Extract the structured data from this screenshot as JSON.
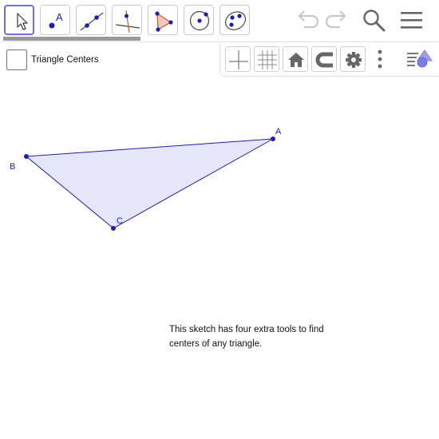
{
  "colors": {
    "accent": "#6d6ee0",
    "point": "#1e1ea8",
    "triangle_fill": "#e6e6fa",
    "triangle_stroke": "#1e1ea8",
    "icon_gray": "#666666"
  },
  "toolbar": {
    "tools": [
      {
        "name": "move-tool",
        "icon": "cursor-arrow-icon",
        "active": true
      },
      {
        "name": "point-tool",
        "icon": "point-icon",
        "label": "A"
      },
      {
        "name": "line-tool",
        "icon": "line-icon"
      },
      {
        "name": "perpendicular-line-tool",
        "icon": "perpendicular-line-icon"
      },
      {
        "name": "polygon-tool",
        "icon": "polygon-icon"
      },
      {
        "name": "circle-center-point-tool",
        "icon": "circle-icon"
      },
      {
        "name": "ellipse-tool",
        "icon": "ellipse-icon"
      }
    ],
    "right_icons": [
      "undo-icon",
      "redo-icon",
      "search-icon",
      "menu-icon"
    ]
  },
  "checkbox": {
    "label": "Triangle Centers",
    "checked": false
  },
  "graphics_style_bar": [
    "axes-icon",
    "grid-icon",
    "home-icon",
    "magnet-icon",
    "settings-gear-icon",
    "more-vertical-icon",
    "toggle-style-bar-icon"
  ],
  "points": {
    "A": {
      "label": "A"
    },
    "B": {
      "label": "B"
    },
    "C": {
      "label": "C"
    }
  },
  "note": {
    "line1": "This sketch has four extra tools to find",
    "line2": "centers of any triangle."
  }
}
